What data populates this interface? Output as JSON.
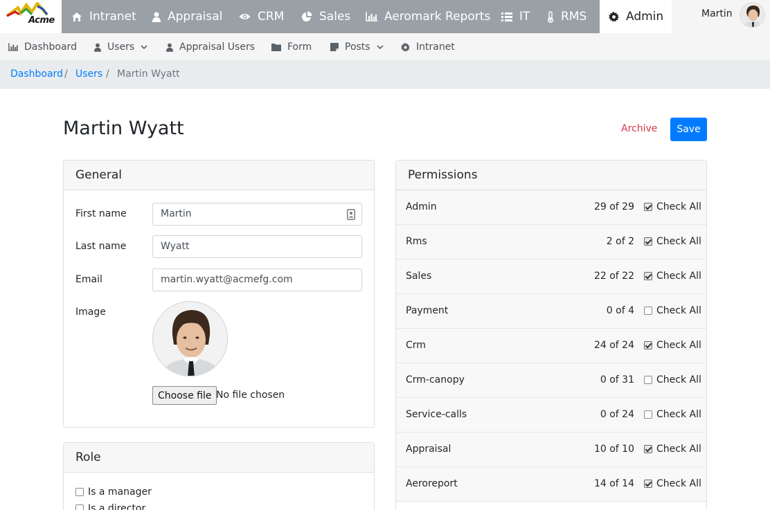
{
  "brand": {
    "name": "Acme"
  },
  "topnav": {
    "items": [
      {
        "label": "Intranet",
        "icon": "home-icon"
      },
      {
        "label": "Appraisal",
        "icon": "user-icon"
      },
      {
        "label": "CRM",
        "icon": "eye-icon"
      },
      {
        "label": "Sales",
        "icon": "pie-chart-icon"
      },
      {
        "label": "Aeromark Reports",
        "icon": "bar-chart-icon"
      },
      {
        "label": "IT",
        "icon": "list-icon"
      },
      {
        "label": "RMS",
        "icon": "thermometer-icon"
      },
      {
        "label": "Admin",
        "icon": "gear-icon",
        "active": true
      }
    ],
    "user": {
      "name": "Martin"
    }
  },
  "subnav": {
    "items": [
      {
        "label": "Dashboard",
        "icon": "bar-chart-icon"
      },
      {
        "label": "Users",
        "icon": "user-icon",
        "dropdown": true
      },
      {
        "label": "Appraisal Users",
        "icon": "user-icon"
      },
      {
        "label": "Form",
        "icon": "folder-icon"
      },
      {
        "label": "Posts",
        "icon": "note-icon",
        "dropdown": true
      },
      {
        "label": "Intranet",
        "icon": "gear-icon"
      }
    ]
  },
  "breadcrumb": {
    "items": [
      "Dashboard",
      "Users",
      "Martin Wyatt"
    ],
    "separator": "/"
  },
  "page": {
    "title": "Martin Wyatt",
    "archive_label": "Archive",
    "save_label": "Save"
  },
  "general": {
    "title": "General",
    "first_name_label": "First name",
    "first_name": "Martin",
    "last_name_label": "Last name",
    "last_name": "Wyatt",
    "email_label": "Email",
    "email": "martin.wyatt@acmefg.com",
    "image_label": "Image",
    "file_button": "Choose file",
    "file_status": "No file chosen"
  },
  "role": {
    "title": "Role",
    "options": [
      {
        "label": "Is a manager",
        "checked": false
      },
      {
        "label": "Is a director",
        "checked": false
      }
    ]
  },
  "permissions": {
    "title": "Permissions",
    "check_all_label": "Check All",
    "rows": [
      {
        "name": "Admin",
        "count": "29 of 29",
        "checked": true
      },
      {
        "name": "Rms",
        "count": "2 of 2",
        "checked": true
      },
      {
        "name": "Sales",
        "count": "22 of 22",
        "checked": true
      },
      {
        "name": "Payment",
        "count": "0 of 4",
        "checked": false
      },
      {
        "name": "Crm",
        "count": "24 of 24",
        "checked": true
      },
      {
        "name": "Crm-canopy",
        "count": "0 of 31",
        "checked": false
      },
      {
        "name": "Service-calls",
        "count": "0 of 24",
        "checked": false
      },
      {
        "name": "Appraisal",
        "count": "10 of 10",
        "checked": true
      },
      {
        "name": "Aeroreport",
        "count": "14 of 14",
        "checked": true
      }
    ]
  },
  "colors": {
    "navbar": "#9aa1a6",
    "primary": "#007bff",
    "danger": "#dc3545"
  }
}
